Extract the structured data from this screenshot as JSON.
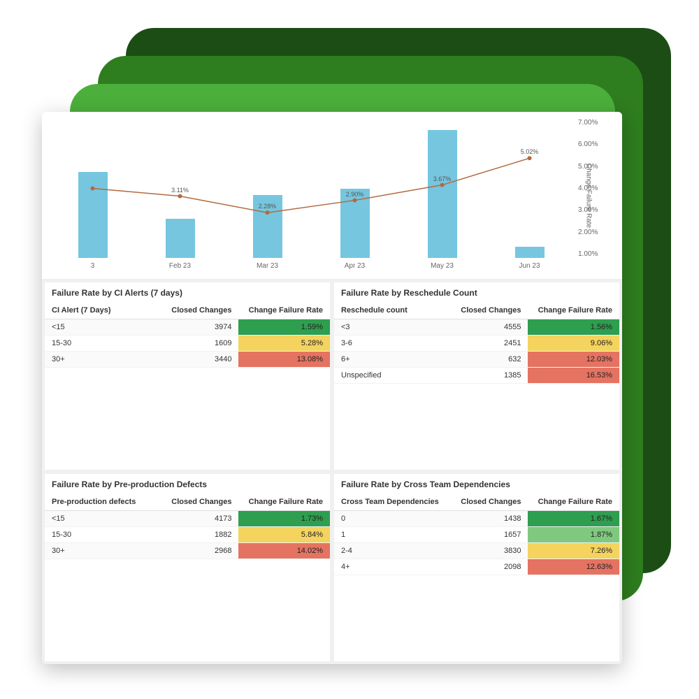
{
  "chart_data": {
    "type": "bar",
    "categories": [
      "3",
      "Feb 23",
      "Mar 23",
      "Apr 23",
      "May 23",
      "Jun 23"
    ],
    "bar_series": {
      "name": "Closed Changes",
      "values_rel": [
        0.62,
        0.28,
        0.45,
        0.5,
        0.92,
        0.08
      ],
      "color": "#76c6e0"
    },
    "line_series": {
      "name": "Change Failure Rate",
      "values": [
        3.5,
        3.11,
        2.28,
        2.9,
        3.67,
        5.02
      ],
      "color": "#b36a3e",
      "labels": [
        "",
        "3.11%",
        "2.28%",
        "2.90%",
        "3.67%",
        "5.02%"
      ]
    },
    "y2": {
      "label": "Change Failure Rate",
      "ticks": [
        "7.00%",
        "6.00%",
        "5.00%",
        "4.00%",
        "3.00%",
        "2.00%",
        "1.00%"
      ],
      "min": 0,
      "max": 7
    }
  },
  "cards": [
    {
      "title": "Failure Rate by CI Alerts (7 days)",
      "cols": [
        "CI Alert (7 Days)",
        "Closed Changes",
        "Change Failure Rate"
      ],
      "rows": [
        {
          "c0": "<15",
          "c1": "3974",
          "c2": "1.59%",
          "sev": "green"
        },
        {
          "c0": "15-30",
          "c1": "1609",
          "c2": "5.28%",
          "sev": "yellow"
        },
        {
          "c0": "30+",
          "c1": "3440",
          "c2": "13.08%",
          "sev": "red"
        }
      ]
    },
    {
      "title": "Failure Rate by Reschedule Count",
      "cols": [
        "Reschedule count",
        "Closed Changes",
        "Change Failure Rate"
      ],
      "rows": [
        {
          "c0": "<3",
          "c1": "4555",
          "c2": "1.56%",
          "sev": "green"
        },
        {
          "c0": "3-6",
          "c1": "2451",
          "c2": "9.06%",
          "sev": "yellow"
        },
        {
          "c0": "6+",
          "c1": "632",
          "c2": "12.03%",
          "sev": "red"
        },
        {
          "c0": "Unspecified",
          "c1": "1385",
          "c2": "16.53%",
          "sev": "red"
        }
      ]
    },
    {
      "title": "Failure Rate by Pre-production Defects",
      "cols": [
        "Pre-production defects",
        "Closed Changes",
        "Change Failure Rate"
      ],
      "rows": [
        {
          "c0": "<15",
          "c1": "4173",
          "c2": "1.73%",
          "sev": "green"
        },
        {
          "c0": "15-30",
          "c1": "1882",
          "c2": "5.84%",
          "sev": "yellow"
        },
        {
          "c0": "30+",
          "c1": "2968",
          "c2": "14.02%",
          "sev": "red"
        }
      ]
    },
    {
      "title": "Failure Rate by Cross Team Dependencies",
      "cols": [
        "Cross Team Dependencies",
        "Closed Changes",
        "Change Failure Rate"
      ],
      "rows": [
        {
          "c0": "0",
          "c1": "1438",
          "c2": "1.67%",
          "sev": "green"
        },
        {
          "c0": "1",
          "c1": "1657",
          "c2": "1.87%",
          "sev": "lgreen"
        },
        {
          "c0": "2-4",
          "c1": "3830",
          "c2": "7.26%",
          "sev": "yellow"
        },
        {
          "c0": "4+",
          "c1": "2098",
          "c2": "12.63%",
          "sev": "red"
        }
      ]
    }
  ]
}
